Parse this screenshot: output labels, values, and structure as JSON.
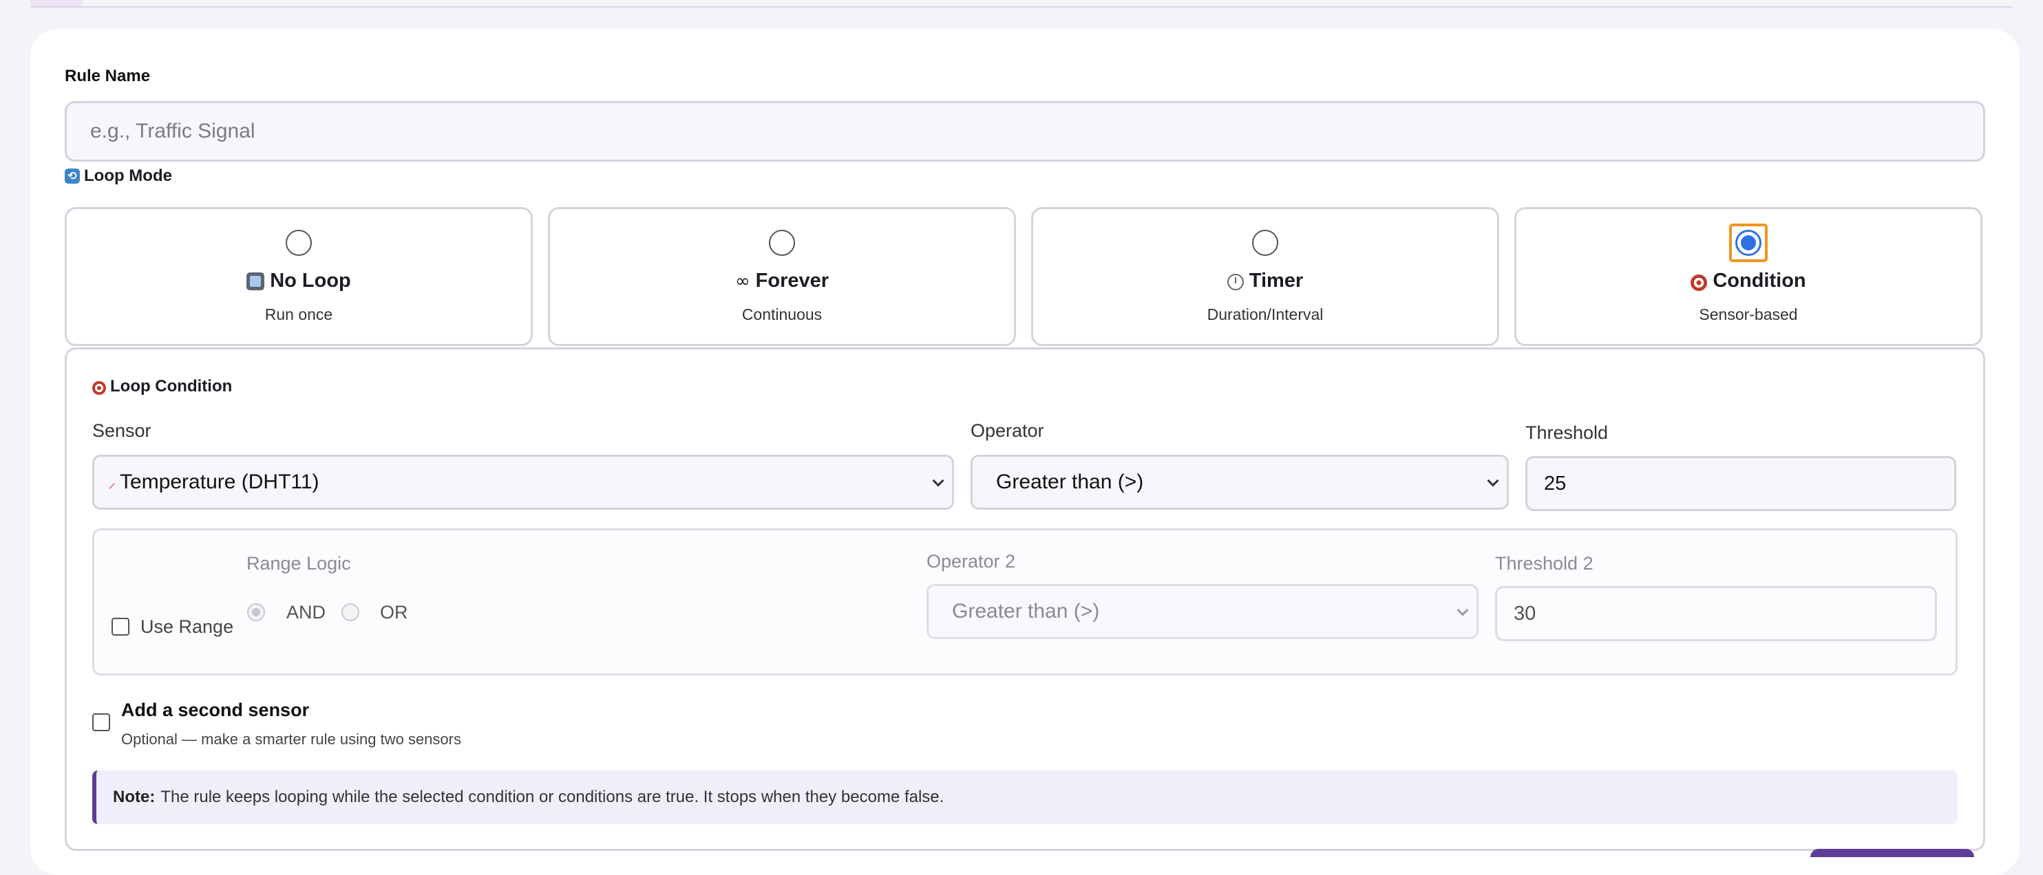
{
  "form": {
    "rule_name_label": "Rule Name",
    "rule_name_placeholder": "e.g., Traffic Signal",
    "rule_name_value": ""
  },
  "loop_mode": {
    "label": "Loop Mode",
    "icon": "loop-arrows-icon",
    "selected": "condition",
    "options": [
      {
        "id": "no-loop",
        "icon": "stop-square-icon",
        "title": "No Loop",
        "subtitle": "Run once"
      },
      {
        "id": "forever",
        "icon": "infinity-icon",
        "title": "Forever",
        "subtitle": "Continuous"
      },
      {
        "id": "timer",
        "icon": "stopwatch-icon",
        "title": "Timer",
        "subtitle": "Duration/Interval"
      },
      {
        "id": "condition",
        "icon": "target-icon",
        "title": "Condition",
        "subtitle": "Sensor-based"
      }
    ]
  },
  "loop_condition": {
    "title": "Loop Condition",
    "sensor_label": "Sensor",
    "sensor_value": "Temperature (DHT11)",
    "sensor_icon": "thermometer-icon",
    "operator_label": "Operator",
    "operator_value": "Greater than (>)",
    "threshold_label": "Threshold",
    "threshold_value": "25",
    "range": {
      "use_range_label": "Use Range",
      "use_range_checked": false,
      "logic_label": "Range Logic",
      "and_label": "AND",
      "or_label": "OR",
      "logic_selected": "AND",
      "operator2_label": "Operator 2",
      "operator2_value": "Greater than (>)",
      "threshold2_label": "Threshold 2",
      "threshold2_value": "30"
    },
    "second_sensor": {
      "title": "Add a second sensor",
      "subtitle": "Optional — make a smarter rule using two sensors",
      "checked": false
    },
    "note": {
      "label": "Note:",
      "text": "The rule keeps looping while the selected condition or conditions are true. It stops when they become false."
    }
  },
  "colors": {
    "accent": "#5e3d94",
    "radio_selected": "#2e72e6",
    "focus_ring": "#ee9522",
    "note_bg": "#efeefb"
  }
}
